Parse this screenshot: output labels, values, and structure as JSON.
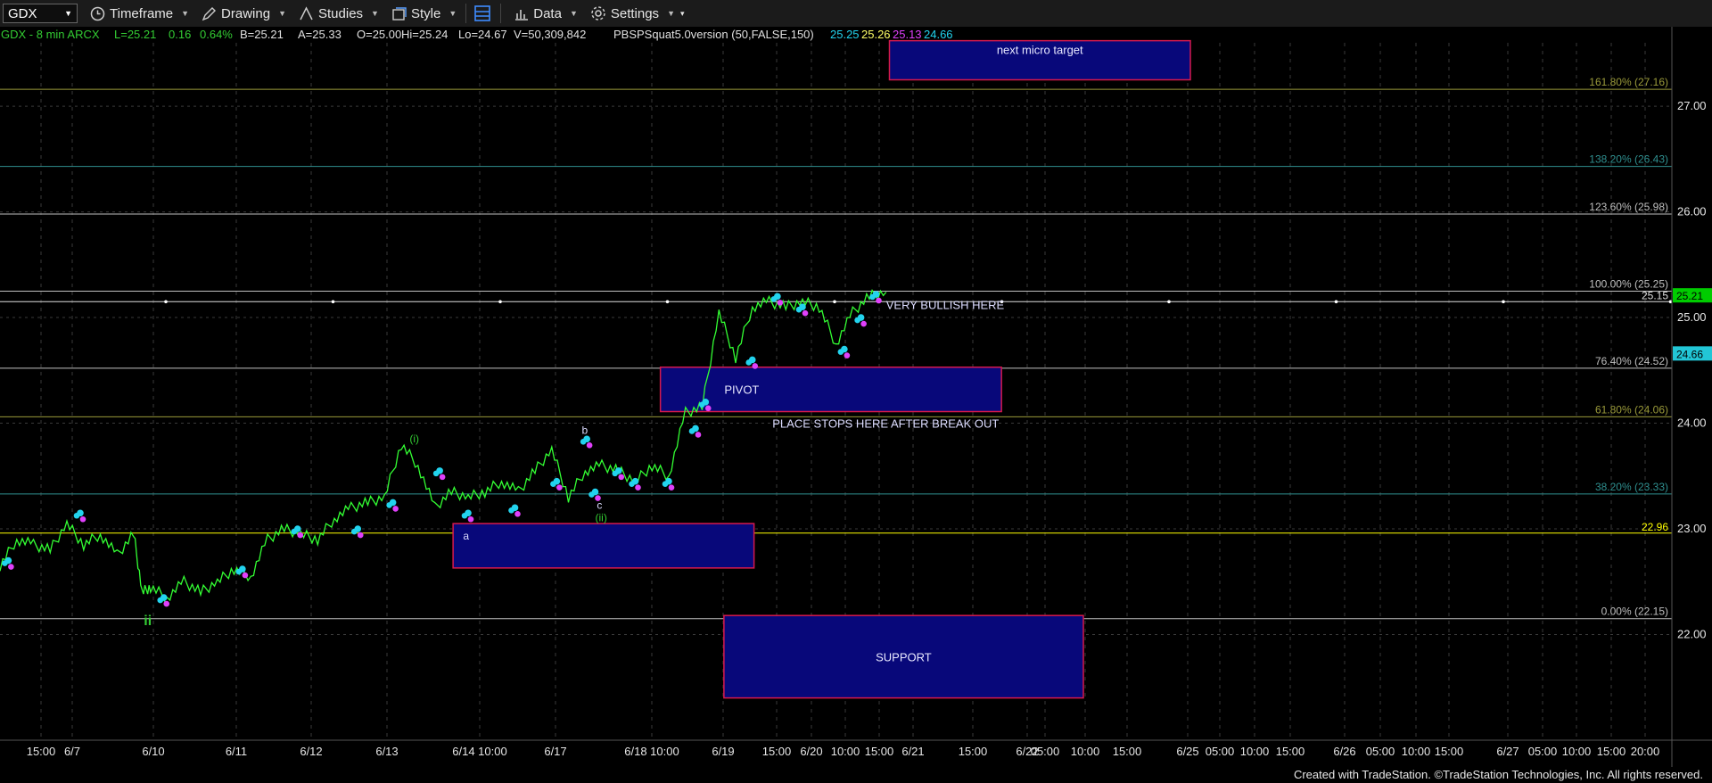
{
  "toolbar": {
    "symbol": "GDX",
    "timeframe": "Timeframe",
    "drawing": "Drawing",
    "studies": "Studies",
    "style": "Style",
    "data": "Data",
    "settings": "Settings"
  },
  "header": {
    "symbol_line": "GDX - 8 min  ARCX",
    "last": "L=25.21",
    "change": "0.16",
    "pct": "0.64%",
    "bid": "B=25.21",
    "ask": "A=25.33",
    "open": "O=25.00",
    "high": "Hi=25.24",
    "low": "Lo=24.67",
    "volume": "V=50,309,842",
    "study": "PBSPSquat5.0version (50,FALSE,150)",
    "study_values": [
      "25.25",
      "25.26",
      "25.13",
      "24.66"
    ]
  },
  "footer": "Created with TradeStation. ©TradeStation Technologies, Inc. All rights reserved.",
  "colors": {
    "bg": "#000000",
    "grid": "#3a3a3a",
    "price_line": "#33ff33",
    "cyan_dot": "#22d3ee",
    "magenta_dot": "#e040fb",
    "box_fill": "#08087a",
    "box_border": "#d6194d",
    "fib_olive": "#9a9a3a",
    "fib_teal": "#2f8f8f",
    "fib_gray": "#bfbfbf",
    "label_green": "#33cc33",
    "value_yellow": "#ffff00"
  },
  "chart_data": {
    "type": "line",
    "ylim": [
      21.0,
      27.6
    ],
    "y_ticks": [
      "27.00",
      "26.00",
      "25.00",
      "24.00",
      "23.00",
      "22.00"
    ],
    "x_ticks": [
      "15:00",
      "6/7",
      "6/10",
      "6/11",
      "6/12",
      "6/13",
      "6/14 10:00",
      "6/17",
      "6/18 10:00",
      "6/19",
      "15:00",
      "6/20",
      "10:00",
      "15:00",
      "6/21",
      "15:00",
      "6/22",
      "05:00",
      "10:00",
      "15:00",
      "6/25",
      "05:00",
      "10:00",
      "15:00",
      "6/26",
      "05:00",
      "10:00",
      "15:00",
      "6/27",
      "05:00",
      "10:00",
      "15:00",
      "20:00"
    ],
    "fib_levels": [
      {
        "label": "161.80% (27.16)",
        "value": 27.16
      },
      {
        "label": "138.20% (26.43)",
        "value": 26.43
      },
      {
        "label": "123.60% (25.98)",
        "value": 25.98
      },
      {
        "label": "100.00% (25.25)",
        "value": 25.25
      },
      {
        "label": "76.40% (24.52)",
        "value": 24.52
      },
      {
        "label": "61.80% (24.06)",
        "value": 24.06
      },
      {
        "label": "38.20% (23.33)",
        "value": 23.33
      },
      {
        "label": "0.00% (22.15)",
        "value": 22.15
      }
    ],
    "hlines": [
      {
        "label": "25.15",
        "value": 25.15
      },
      {
        "label": "22.96",
        "value": 22.96
      }
    ],
    "price_tags": [
      {
        "label": "25.21",
        "value": 25.21
      },
      {
        "label": "24.66",
        "value": 24.66
      }
    ],
    "boxes": [
      {
        "label": "next micro target",
        "x0": 53.2,
        "x1": 71.2,
        "y0": 27.62,
        "y1": 27.25
      },
      {
        "label": "PIVOT",
        "x0": 39.5,
        "x1": 59.9,
        "y0": 24.53,
        "y1": 24.11
      },
      {
        "label": "",
        "x0": 27.1,
        "x1": 45.1,
        "y0": 23.05,
        "y1": 22.63
      },
      {
        "label": "SUPPORT",
        "x0": 43.3,
        "x1": 64.8,
        "y0": 22.18,
        "y1": 21.4
      }
    ],
    "annotations": [
      {
        "text": "VERY BULLISH HERE",
        "x": 53.0,
        "y": 25.08
      },
      {
        "text": "PLACE STOPS HERE AFTER BREAK OUT",
        "x": 46.2,
        "y": 23.96
      },
      {
        "text": "(i)",
        "x": 24.5,
        "y": 23.82
      },
      {
        "text": "b",
        "x": 34.8,
        "y": 23.9
      },
      {
        "text": "c",
        "x": 35.7,
        "y": 23.19
      },
      {
        "text": "(ii)",
        "x": 35.6,
        "y": 23.07
      },
      {
        "text": "a",
        "x": 27.7,
        "y": 22.9
      },
      {
        "text": "ii",
        "x": 8.6,
        "y": 22.09
      }
    ],
    "series": [
      {
        "x": [
          0,
          1,
          2,
          3,
          4,
          5,
          6,
          7,
          8,
          8.5,
          9,
          10,
          11,
          12,
          13,
          14,
          15,
          16,
          17,
          18,
          19,
          20,
          21,
          22,
          23,
          24,
          25,
          26,
          27,
          28,
          29,
          30,
          31,
          32,
          33,
          34,
          35,
          36,
          37,
          38,
          39,
          40,
          41,
          42,
          43,
          44,
          45,
          46,
          47,
          48,
          49,
          50,
          51,
          52,
          53
        ],
        "values": [
          22.65,
          22.9,
          22.85,
          22.8,
          23.05,
          22.85,
          22.95,
          22.75,
          22.95,
          22.4,
          22.45,
          22.35,
          22.5,
          22.4,
          22.5,
          22.62,
          22.55,
          22.9,
          23.0,
          22.95,
          22.9,
          23.1,
          23.2,
          23.25,
          23.3,
          23.8,
          23.6,
          23.2,
          23.35,
          23.3,
          23.35,
          23.45,
          23.35,
          23.55,
          23.75,
          23.3,
          23.55,
          23.6,
          23.55,
          23.45,
          23.6,
          23.5,
          24.1,
          24.15,
          25.05,
          24.62,
          25.1,
          25.15,
          25.1,
          25.15,
          25.1,
          24.75,
          25.05,
          25.2,
          25.24
        ]
      }
    ],
    "pivots": [
      {
        "x": 0.5,
        "y": 22.7,
        "type": "low"
      },
      {
        "x": 4.8,
        "y": 23.15,
        "type": "high"
      },
      {
        "x": 9.8,
        "y": 22.35,
        "type": "low"
      },
      {
        "x": 14.5,
        "y": 22.62,
        "type": "high"
      },
      {
        "x": 17.8,
        "y": 23.0,
        "type": "high"
      },
      {
        "x": 21.4,
        "y": 23.0,
        "type": "low"
      },
      {
        "x": 23.5,
        "y": 23.25,
        "type": "high"
      },
      {
        "x": 26.3,
        "y": 23.55,
        "type": "high"
      },
      {
        "x": 28.0,
        "y": 23.15,
        "type": "low"
      },
      {
        "x": 30.8,
        "y": 23.2,
        "type": "low"
      },
      {
        "x": 33.3,
        "y": 23.45,
        "type": "high"
      },
      {
        "x": 35.1,
        "y": 23.85,
        "type": "high"
      },
      {
        "x": 35.6,
        "y": 23.35,
        "type": "low"
      },
      {
        "x": 37.0,
        "y": 23.55,
        "type": "high"
      },
      {
        "x": 38.0,
        "y": 23.45,
        "type": "low"
      },
      {
        "x": 40.0,
        "y": 23.45,
        "type": "low"
      },
      {
        "x": 41.6,
        "y": 23.95,
        "type": "high"
      },
      {
        "x": 42.2,
        "y": 24.2,
        "type": "high"
      },
      {
        "x": 45.0,
        "y": 24.6,
        "type": "low"
      },
      {
        "x": 46.5,
        "y": 25.2,
        "type": "high"
      },
      {
        "x": 48.0,
        "y": 25.1,
        "type": "high"
      },
      {
        "x": 50.5,
        "y": 24.7,
        "type": "low"
      },
      {
        "x": 51.5,
        "y": 25.0,
        "type": "high"
      },
      {
        "x": 52.4,
        "y": 25.22,
        "type": "high"
      }
    ]
  }
}
